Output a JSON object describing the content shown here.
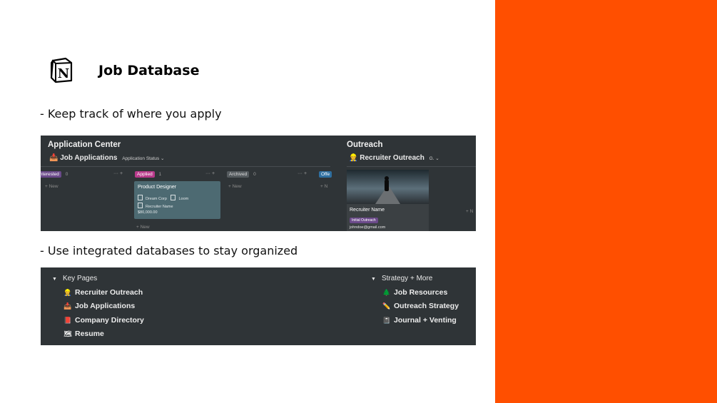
{
  "title": "Job Database",
  "captions": {
    "first": "- Keep track of where you apply",
    "second": "- Use integrated databases to stay organized"
  },
  "colors": {
    "accent": "#FF4F00",
    "dark_bg": "#2f3437"
  },
  "logo_icon": "notion-logo-icon",
  "screenshot1": {
    "application_center": "Application Center",
    "job_applications": "Job Applications",
    "group_by": "Application Status ⌄",
    "columns": [
      {
        "label": "Interested",
        "count": "0",
        "actions": "··· +"
      },
      {
        "label": "Applied",
        "count": "1",
        "actions": "··· +"
      },
      {
        "label": "Archived",
        "count": "0",
        "actions": "··· +"
      },
      {
        "label": "Offe",
        "count": ""
      }
    ],
    "new_label": "+ New",
    "new_label_short": "+ N",
    "card": {
      "title": "Product Designer",
      "company": "Dream Corp",
      "company_extra": "Loom",
      "recruiter": "Recruiter Name",
      "salary": "$80,000.00"
    },
    "outreach": "Outreach",
    "recruiter_outreach": "Recruiter Outreach",
    "outreach_view": "G. ⌄",
    "outreach_card": {
      "name": "Recruiter Name",
      "tag": "Initial Outreach",
      "email": "johndoe@gmail.com"
    }
  },
  "screenshot2": {
    "left_header": "Key Pages",
    "left_items": [
      {
        "label": "Recruiter Outreach",
        "icon": "👷"
      },
      {
        "label": "Job Applications",
        "icon": "📥"
      },
      {
        "label": "Company Directory",
        "icon": "📕"
      },
      {
        "label": "Resume",
        "icon": "🗺"
      }
    ],
    "right_header": "Strategy + More",
    "right_items": [
      {
        "label": "Job Resources",
        "icon": "🌲"
      },
      {
        "label": "Outreach Strategy",
        "icon": "✏️"
      },
      {
        "label": "Journal + Venting",
        "icon": "📓"
      }
    ]
  }
}
